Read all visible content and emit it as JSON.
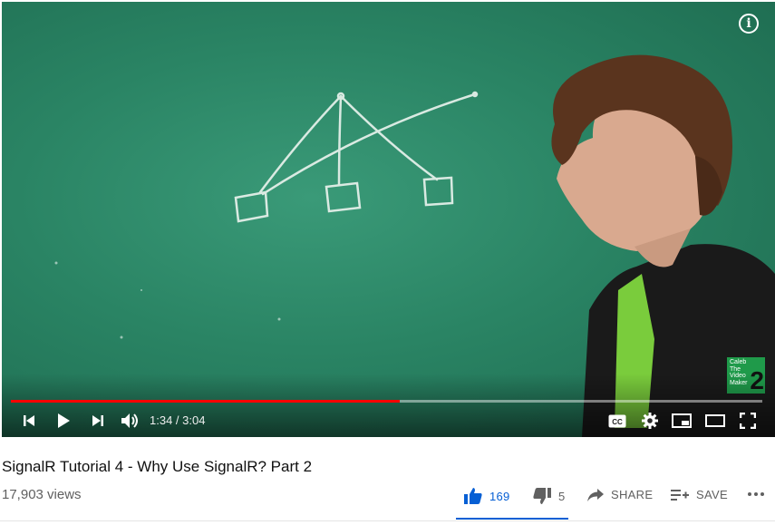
{
  "player": {
    "info_icon": "info-icon",
    "watermark": {
      "text": "Caleb\nThe\nVideo\nMaker",
      "number": "2",
      "color": "#1f9a4a"
    },
    "progress_fraction": 0.517,
    "progress_color": "#ff0000",
    "time": {
      "current": "1:34",
      "separator": " / ",
      "duration": "3:04"
    },
    "controls_left": [
      "previous-icon",
      "play-icon",
      "next-icon",
      "volume-icon"
    ],
    "controls_right": [
      "closed-captions-icon",
      "settings-icon",
      "miniplayer-icon",
      "theater-mode-icon",
      "fullscreen-icon"
    ]
  },
  "video": {
    "title": "SignalR Tutorial 4 - Why Use SignalR? Part 2",
    "views": "17,903 views"
  },
  "actions": {
    "like_count": "169",
    "dislike_count": "5",
    "share_label": "SHARE",
    "save_label": "SAVE",
    "accent_color": "#065fd4"
  }
}
